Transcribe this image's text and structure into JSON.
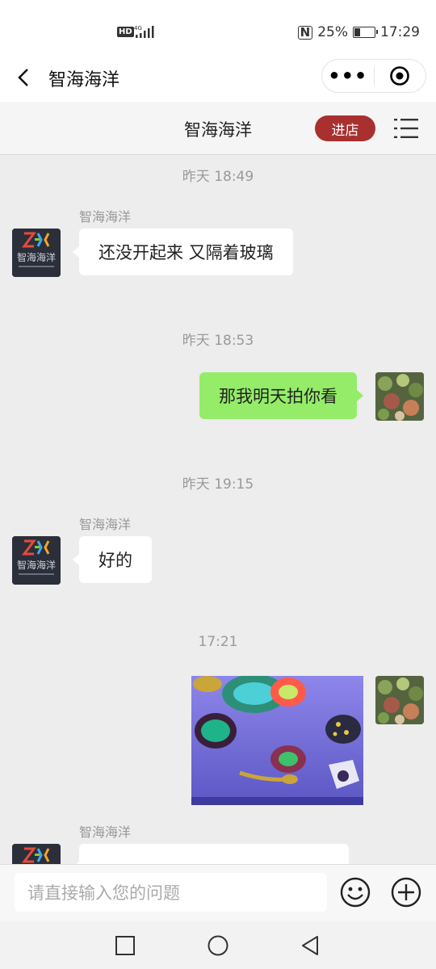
{
  "status_bar": {
    "left_badges": [
      "HD",
      "4G"
    ],
    "battery": "25%",
    "battery_level": 0.25,
    "time": "17:29"
  },
  "nav_bar": {
    "title": "智海海洋",
    "more_icon": "more-dots-icon",
    "close_icon": "target-icon"
  },
  "shop_bar": {
    "title": "智海海洋",
    "enter_label": "进店",
    "menu_icon": "menu-icon"
  },
  "messages": [
    {
      "type": "time",
      "text": "昨天 18:49"
    },
    {
      "type": "incoming",
      "sender": "智海海洋",
      "text": "还没开起来 又隔着玻璃"
    },
    {
      "type": "time",
      "text": "昨天 18:53"
    },
    {
      "type": "outgoing",
      "text": "那我明天拍你看"
    },
    {
      "type": "time",
      "text": "昨天 19:15"
    },
    {
      "type": "incoming",
      "sender": "智海海洋",
      "text": "好的"
    },
    {
      "type": "time",
      "text": "17:21"
    },
    {
      "type": "outgoing-image"
    },
    {
      "type": "incoming",
      "sender": "智海海洋",
      "text": ""
    }
  ],
  "avatar_logo_text": "智海海洋",
  "input_bar": {
    "placeholder": "请直接输入您的问题",
    "emoji_icon": "emoji-icon",
    "plus_icon": "plus-icon"
  },
  "colors": {
    "accent_red": "#a8302f",
    "bubble_green": "#95ec69",
    "background": "#ededed"
  }
}
